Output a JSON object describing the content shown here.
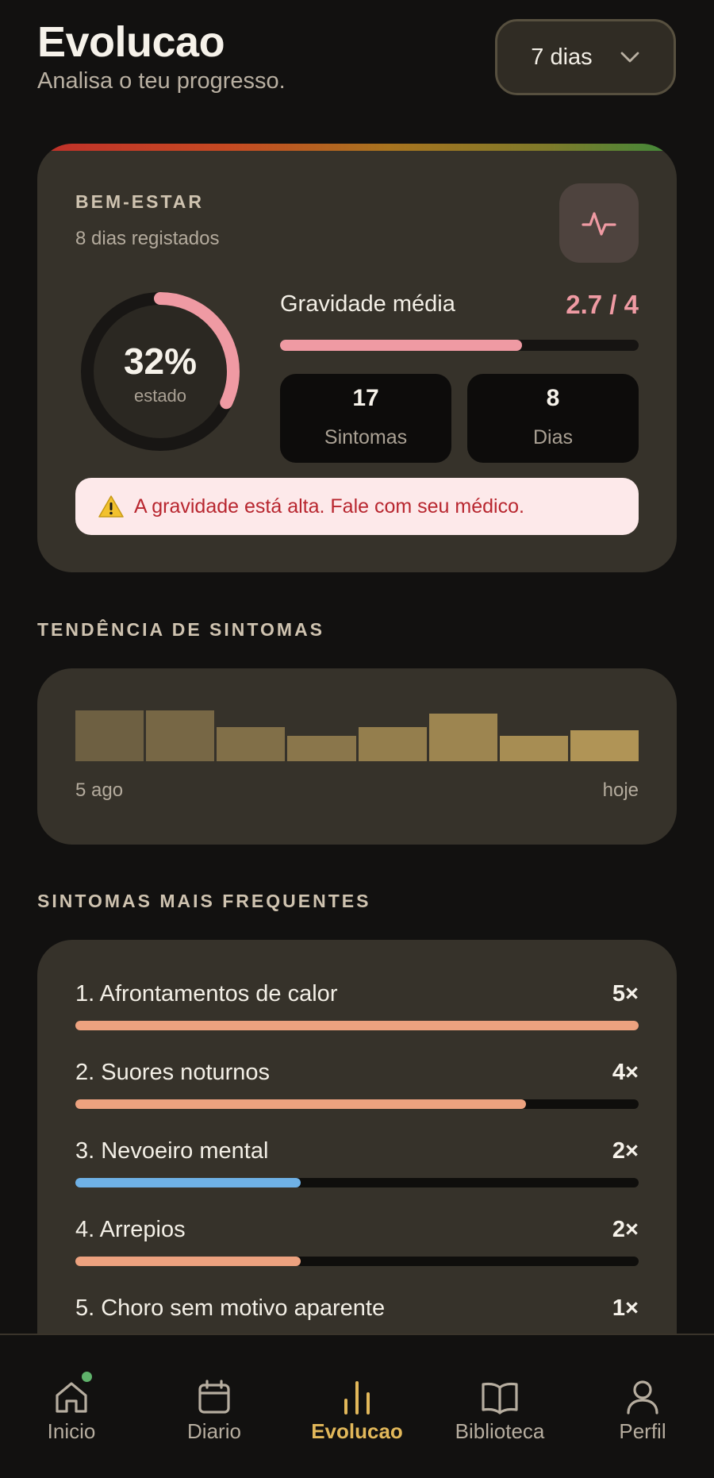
{
  "header": {
    "title": "Evolucao",
    "subtitle": "Analisa o teu progresso."
  },
  "period_select": {
    "value": "7 dias",
    "icon": "chevron-down-icon"
  },
  "wellbeing": {
    "label": "BEM-ESTAR",
    "subtitle": "8 dias registados",
    "icon": "pulse-icon",
    "score_percent": 32,
    "score_text": "32%",
    "score_caption": "estado",
    "severity_label": "Gravidade média",
    "severity_value": "2.7 / 4",
    "severity_fraction": 0.675,
    "stats": [
      {
        "value": "17",
        "label": "Sintomas"
      },
      {
        "value": "8",
        "label": "Dias"
      }
    ],
    "alert_icon": "warning-icon",
    "alert_text": "A gravidade está alta. Fale com seu médico.",
    "colors": {
      "accent": "#ef9aa3",
      "alert_text": "#b8262f",
      "alert_bg": "#fde9ea"
    }
  },
  "trend": {
    "title": "TENDÊNCIA DE SINTOMAS",
    "start_label": "5 ago",
    "end_label": "hoje",
    "chart_data": {
      "type": "bar",
      "values": [
        3,
        3,
        2,
        1.5,
        2,
        2.8,
        1.5,
        1.8
      ],
      "ylim": [
        0,
        3.6
      ],
      "grid": false
    }
  },
  "frequent": {
    "title": "SINTOMAS MAIS FREQUENTES",
    "max_count": 5,
    "items": [
      {
        "name": "1. Afrontamentos de calor",
        "count_text": "5×",
        "count": 5,
        "color": "#eda27f"
      },
      {
        "name": "2. Suores noturnos",
        "count_text": "4×",
        "count": 4,
        "color": "#eda27f"
      },
      {
        "name": "3. Nevoeiro mental",
        "count_text": "2×",
        "count": 2,
        "color": "#6fb1e6"
      },
      {
        "name": "4. Arrepios",
        "count_text": "2×",
        "count": 2,
        "color": "#eda27f"
      },
      {
        "name": "5. Choro sem motivo aparente",
        "count_text": "1×",
        "count": 1,
        "color": "#eda27f"
      }
    ]
  },
  "nav": {
    "items": [
      {
        "label": "Inicio",
        "icon": "home-icon",
        "active": false,
        "badge": true
      },
      {
        "label": "Diario",
        "icon": "calendar-icon",
        "active": false
      },
      {
        "label": "Evolucao",
        "icon": "bar-chart-icon",
        "active": true
      },
      {
        "label": "Biblioteca",
        "icon": "book-icon",
        "active": false
      },
      {
        "label": "Perfil",
        "icon": "user-icon",
        "active": false
      }
    ]
  }
}
